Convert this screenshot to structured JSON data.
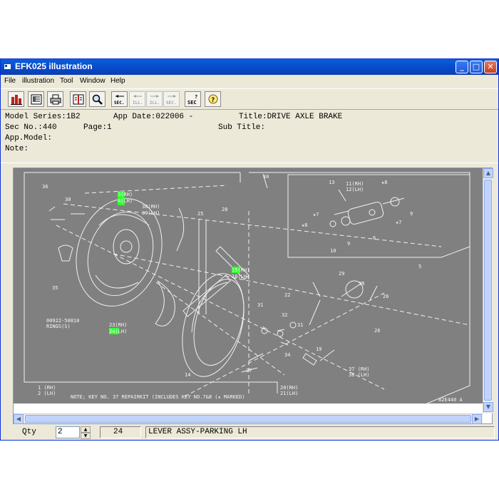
{
  "window": {
    "title": "EFK025 illustration",
    "accent": "#0a5fd8"
  },
  "caption_buttons": {
    "minimize": "_",
    "maximize": "□",
    "close": "✕"
  },
  "menu": [
    "File",
    "illustration",
    "Tool",
    "Window",
    "Help"
  ],
  "toolbar": {
    "buttons": [
      {
        "name": "catalog-icon",
        "label": ""
      },
      {
        "name": "parts-list-icon",
        "label": ""
      },
      {
        "name": "print-icon",
        "label": ""
      },
      {
        "name": "book-icon",
        "label": ""
      },
      {
        "name": "search-icon",
        "label": ""
      },
      {
        "name": "sec-prev-icon",
        "label": "SEC."
      },
      {
        "name": "ill-prev-icon",
        "label": "ILL."
      },
      {
        "name": "ill-next-icon",
        "label": "ILL."
      },
      {
        "name": "sec-next-icon",
        "label": "SEC."
      },
      {
        "name": "sec-query-icon",
        "label": "SEC"
      },
      {
        "name": "help-icon",
        "label": ""
      }
    ]
  },
  "info": {
    "model_series": "Model Series:1B2",
    "app_date": "App Date:022006 -",
    "title": "Title:DRIVE AXLE BRAKE",
    "sec_no": "Sec No.:440",
    "page": "Page:1",
    "sub_title": "Sub Title:",
    "app_model": "App.Model:",
    "note": "Note:"
  },
  "drawing": {
    "highlight": "#33ff33",
    "note": "NOTE; KEY NO. 37 REPAIRKIT (INCLUDES KEY NO.7&8 (★ MARKED)",
    "figure_id": "82E440 A",
    "labels": {
      "l36": "36",
      "l30": "30",
      "l3rh": "3(RH)",
      "l4lh": "4(LH)",
      "l38rh": "38(RH)",
      "l39lh": "39(LH)",
      "l25": "25",
      "l28": "28",
      "l40": "40",
      "l13": "13",
      "l11rh": "11(RH)",
      "l12lh": "12(LH)",
      "s8a": "★8",
      "s7a": "★7",
      "s8b": "★8",
      "s7b": "★7",
      "l9a": "9",
      "l6": "6",
      "l9b": "9",
      "l10": "10",
      "l5": "5",
      "l35": "35",
      "l15rh": "15(RH)",
      "l16lh": "16(LH)",
      "l29": "29",
      "l22": "22",
      "l33": "33",
      "l26a": "26",
      "l26b": "26",
      "part_no": "00922-50810",
      "rings": "RINGS(S)",
      "l23rh": "23(RH)",
      "l24lh": "24(LH)",
      "l31a": "31",
      "l32": "32",
      "l31b": "31",
      "l19": "19",
      "l34": "34",
      "l14": "14",
      "l27": "27",
      "l37rh": "37 (RH)",
      "l38lh": "38 (LH)",
      "l20rh": "20(RH)",
      "l21lh": "21(LH)",
      "l1rh": "1 (RH)",
      "l2lh": "2 (LH)"
    }
  },
  "status": {
    "qty_label": "Qty",
    "qty_value": "2",
    "key_no": "24",
    "part_name": "LEVER ASSY-PARKING LH"
  }
}
